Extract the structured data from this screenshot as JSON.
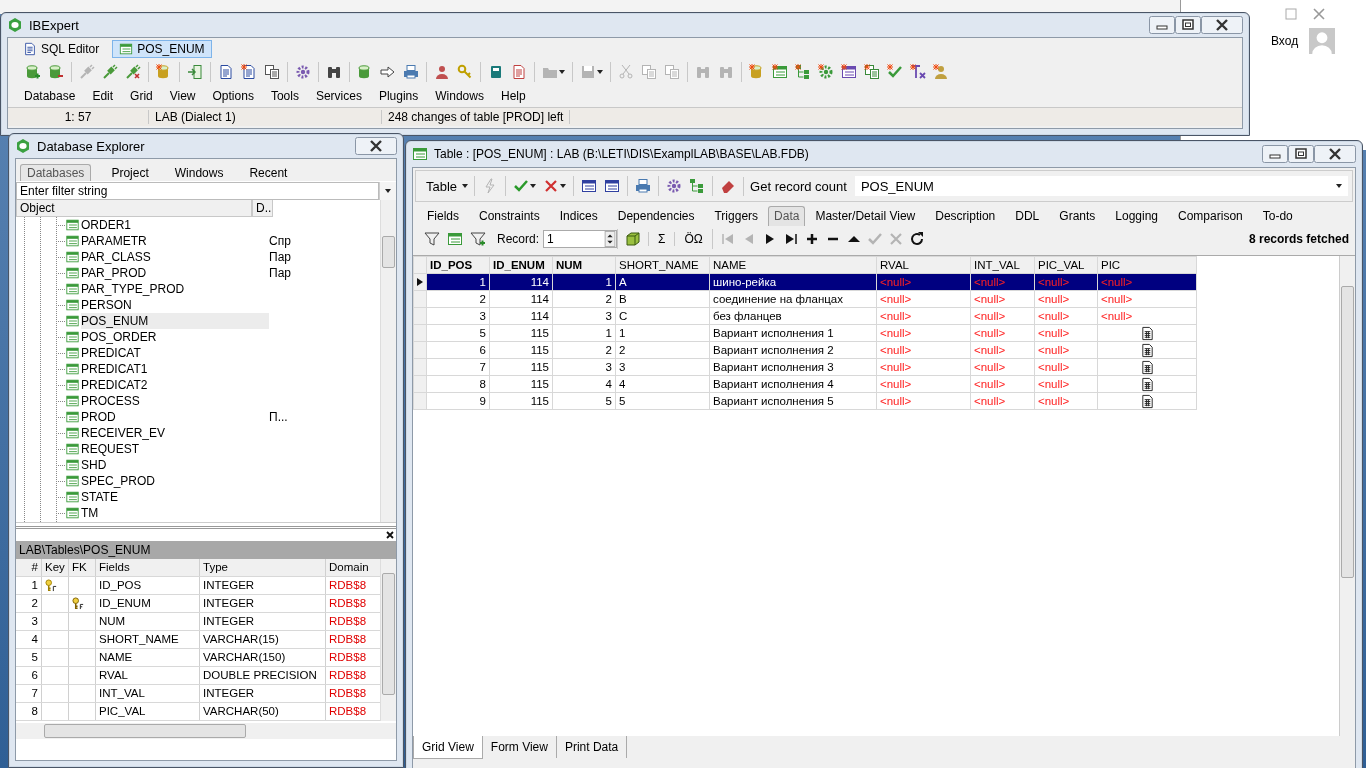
{
  "desktop": {
    "login_text": "Вход"
  },
  "main_window": {
    "title": "IBExpert",
    "doc_tabs": [
      {
        "label": "SQL Editor",
        "kind": "sql",
        "selected": false
      },
      {
        "label": "POS_ENUM",
        "kind": "table",
        "selected": true
      }
    ],
    "toolbar": [
      [
        {
          "kind": "db-add",
          "disabled": false
        },
        {
          "kind": "db-remove",
          "disabled": false
        }
      ],
      [
        {
          "kind": "plug",
          "disabled": true
        },
        {
          "kind": "plug",
          "disabled": false
        },
        {
          "kind": "unplug",
          "disabled": false
        }
      ],
      [
        {
          "kind": "db-new",
          "disabled": false
        }
      ],
      [
        {
          "kind": "door",
          "disabled": false
        }
      ],
      [
        {
          "kind": "doc",
          "disabled": false
        },
        {
          "kind": "doc-new",
          "disabled": false
        },
        {
          "kind": "docs",
          "disabled": false
        }
      ],
      [
        {
          "kind": "gear",
          "disabled": false
        }
      ],
      [
        {
          "kind": "binoc",
          "disabled": false
        }
      ],
      [
        {
          "kind": "db",
          "disabled": false
        },
        {
          "kind": "arrow",
          "disabled": false
        },
        {
          "kind": "printer",
          "disabled": false
        }
      ],
      [
        {
          "kind": "person",
          "disabled": false
        },
        {
          "kind": "key",
          "disabled": false
        }
      ],
      [
        {
          "kind": "book",
          "disabled": false
        },
        {
          "kind": "edit",
          "disabled": false
        }
      ],
      [
        {
          "kind": "folder",
          "disabled": true,
          "dropdown": true
        }
      ],
      [
        {
          "kind": "disk",
          "disabled": true,
          "dropdown": true
        }
      ],
      [
        {
          "kind": "scissors",
          "disabled": true
        },
        {
          "kind": "copy",
          "disabled": true
        },
        {
          "kind": "paste",
          "disabled": true
        }
      ],
      [
        {
          "kind": "binoc",
          "disabled": true
        },
        {
          "kind": "binoc",
          "disabled": true
        }
      ],
      [
        {
          "kind": "db-new",
          "disabled": false
        },
        {
          "kind": "grid-new",
          "disabled": false
        },
        {
          "kind": "tree-new",
          "disabled": false
        },
        {
          "kind": "gear-new",
          "disabled": false
        },
        {
          "kind": "list-new",
          "disabled": false
        },
        {
          "kind": "docs-new",
          "disabled": false
        },
        {
          "kind": "check-new",
          "disabled": false
        },
        {
          "kind": "formula-new",
          "disabled": false
        },
        {
          "kind": "person-new",
          "disabled": false
        }
      ]
    ],
    "menu": [
      "Database",
      "Edit",
      "Grid",
      "View",
      "Options",
      "Tools",
      "Services",
      "Plugins",
      "Windows",
      "Help"
    ],
    "status_bar": [
      "1:  57",
      "LAB (Dialect 1)",
      "248 changes of table [PROD] left"
    ]
  },
  "explorer": {
    "title": "Database Explorer",
    "tabs": [
      {
        "label": "Databases",
        "selected": true
      },
      {
        "label": "Project",
        "selected": false
      },
      {
        "label": "Windows",
        "selected": false
      },
      {
        "label": "Recent",
        "selected": false
      }
    ],
    "filter_placeholder": "Enter filter string",
    "tree_columns": [
      "Object",
      "D.."
    ],
    "objects": [
      {
        "name": "ORDER1",
        "selected": false
      },
      {
        "name": "PARAMETR",
        "description": "Спр",
        "selected": false
      },
      {
        "name": "PAR_CLASS",
        "description": "Пар",
        "selected": false
      },
      {
        "name": "PAR_PROD",
        "description": "Пар",
        "selected": false
      },
      {
        "name": "PAR_TYPE_PROD",
        "selected": false
      },
      {
        "name": "PERSON",
        "selected": false
      },
      {
        "name": "POS_ENUM",
        "selected": true
      },
      {
        "name": "POS_ORDER",
        "selected": false
      },
      {
        "name": "PREDICAT",
        "selected": false
      },
      {
        "name": "PREDICAT1",
        "selected": false
      },
      {
        "name": "PREDICAT2",
        "selected": false
      },
      {
        "name": "PROCESS",
        "selected": false
      },
      {
        "name": "PROD",
        "description": "П...",
        "selected": false
      },
      {
        "name": "RECEIVER_EV",
        "selected": false
      },
      {
        "name": "REQUEST",
        "selected": false
      },
      {
        "name": "SHD",
        "selected": false
      },
      {
        "name": "SPEC_PROD",
        "selected": false
      },
      {
        "name": "STATE",
        "selected": false
      },
      {
        "name": "TM",
        "selected": false
      }
    ],
    "fields_panel": {
      "path": "LAB\\Tables\\POS_ENUM",
      "columns": [
        "#",
        "Key",
        "FK",
        "Fields",
        "Type",
        "Domain"
      ],
      "rows": [
        {
          "number": "1",
          "kind": "primary",
          "field": "ID_POS",
          "type": "INTEGER",
          "domain": "RDB$8"
        },
        {
          "number": "2",
          "kind": "foreign",
          "field": "ID_ENUM",
          "type": "INTEGER",
          "domain": "RDB$8"
        },
        {
          "number": "3",
          "field": "NUM",
          "type": "INTEGER",
          "domain": "RDB$8"
        },
        {
          "number": "4",
          "field": "SHORT_NAME",
          "type": "VARCHAR(15)",
          "domain": "RDB$8"
        },
        {
          "number": "5",
          "field": "NAME",
          "type": "VARCHAR(150)",
          "domain": "RDB$8"
        },
        {
          "number": "6",
          "field": "RVAL",
          "type": "DOUBLE PRECISION",
          "domain": "RDB$8"
        },
        {
          "number": "7",
          "field": "INT_VAL",
          "type": "INTEGER",
          "domain": "RDB$8"
        },
        {
          "number": "8",
          "field": "PIC_VAL",
          "type": "VARCHAR(50)",
          "domain": "RDB$8"
        }
      ]
    }
  },
  "table_window": {
    "title": "Table : [POS_ENUM] : LAB (B:\\LETI\\DIS\\ExamplLAB\\BASE\\LAB.FDB)",
    "table_menu": "Table",
    "toolbar": [
      [
        {
          "kind": "lightning",
          "disabled": true
        }
      ],
      [
        {
          "kind": "check",
          "disabled": false,
          "dropdown": true
        },
        {
          "kind": "cross",
          "disabled": false,
          "dropdown": true
        }
      ],
      [
        {
          "kind": "grid-red",
          "disabled": false
        },
        {
          "kind": "grid-red",
          "disabled": false
        }
      ],
      [
        {
          "kind": "printer",
          "disabled": false
        }
      ],
      [
        {
          "kind": "gear",
          "disabled": false
        },
        {
          "kind": "tree",
          "disabled": false
        }
      ],
      [
        {
          "kind": "eraser",
          "disabled": false
        }
      ]
    ],
    "record_count_button": "Get record count",
    "table_combo": "POS_ENUM",
    "tabs": [
      {
        "label": "Fields",
        "selected": false
      },
      {
        "label": "Constraints",
        "selected": false
      },
      {
        "label": "Indices",
        "selected": false
      },
      {
        "label": "Dependencies",
        "selected": false
      },
      {
        "label": "Triggers",
        "selected": false
      },
      {
        "label": "Data",
        "selected": true
      },
      {
        "label": "Master/Detail View",
        "selected": false
      },
      {
        "label": "Description",
        "selected": false
      },
      {
        "label": "DDL",
        "selected": false
      },
      {
        "label": "Grants",
        "selected": false
      },
      {
        "label": "Logging",
        "selected": false
      },
      {
        "label": "Comparison",
        "selected": false
      },
      {
        "label": "To-do",
        "selected": false
      }
    ],
    "data_tools": [
      {
        "kind": "filter",
        "disabled": false
      },
      {
        "kind": "grid",
        "disabled": false
      },
      {
        "kind": "filter-add",
        "disabled": false
      }
    ],
    "record_label": "Record:",
    "record_value": "1",
    "sum_button": "Σ",
    "case_button": "ÖΩ",
    "nav": [
      {
        "kind": "first",
        "disabled": true
      },
      {
        "kind": "prev",
        "disabled": true
      },
      {
        "kind": "next",
        "disabled": false
      },
      {
        "kind": "last",
        "disabled": false
      },
      {
        "kind": "plus",
        "disabled": false
      },
      {
        "kind": "minus",
        "disabled": false
      },
      {
        "kind": "up",
        "disabled": false
      },
      {
        "kind": "check",
        "disabled": true
      },
      {
        "kind": "cross",
        "disabled": true
      },
      {
        "kind": "refresh",
        "disabled": false
      }
    ],
    "fetched": "8 records fetched",
    "grid": {
      "columns": [
        {
          "label": "ID_POS",
          "key": true,
          "kind": "numeric"
        },
        {
          "label": "ID_ENUM",
          "key": true,
          "kind": "numeric"
        },
        {
          "label": "NUM",
          "key": true,
          "kind": "numeric"
        },
        {
          "label": "SHORT_NAME",
          "key": false,
          "kind": "text"
        },
        {
          "label": "NAME",
          "key": false,
          "kind": "text"
        },
        {
          "label": "RVAL",
          "key": false,
          "kind": "text"
        },
        {
          "label": "INT_VAL",
          "key": false,
          "kind": "text"
        },
        {
          "label": "PIC_VAL",
          "key": false,
          "kind": "text"
        },
        {
          "label": "PIC",
          "key": false,
          "kind": "text"
        }
      ],
      "rows": [
        {
          "selected": true,
          "cells": [
            {
              "text": "1"
            },
            {
              "text": "114"
            },
            {
              "text": "1"
            },
            {
              "text": "A"
            },
            {
              "text": "шино-рейка"
            },
            {
              "kind": "null",
              "text": "<null>"
            },
            {
              "kind": "null",
              "text": "<null>"
            },
            {
              "kind": "null",
              "text": "<null>"
            },
            {
              "kind": "null",
              "text": "<null>"
            }
          ]
        },
        {
          "selected": false,
          "cells": [
            {
              "text": "2"
            },
            {
              "text": "114"
            },
            {
              "text": "2"
            },
            {
              "text": "B"
            },
            {
              "text": "соединение на фланцах"
            },
            {
              "kind": "null",
              "text": "<null>"
            },
            {
              "kind": "null",
              "text": "<null>"
            },
            {
              "kind": "null",
              "text": "<null>"
            },
            {
              "kind": "null",
              "text": "<null>"
            }
          ]
        },
        {
          "selected": false,
          "cells": [
            {
              "text": "3"
            },
            {
              "text": "114"
            },
            {
              "text": "3"
            },
            {
              "text": "C"
            },
            {
              "text": "без фланцев"
            },
            {
              "kind": "null",
              "text": "<null>"
            },
            {
              "kind": "null",
              "text": "<null>"
            },
            {
              "kind": "null",
              "text": "<null>"
            },
            {
              "kind": "null",
              "text": "<null>"
            }
          ]
        },
        {
          "selected": false,
          "cells": [
            {
              "text": "5"
            },
            {
              "text": "115"
            },
            {
              "text": "1"
            },
            {
              "text": "1"
            },
            {
              "text": "Вариант исполнения 1"
            },
            {
              "kind": "null",
              "text": "<null>"
            },
            {
              "kind": "null",
              "text": "<null>"
            },
            {
              "kind": "null",
              "text": "<null>"
            },
            {
              "kind": "blob"
            }
          ]
        },
        {
          "selected": false,
          "cells": [
            {
              "text": "6"
            },
            {
              "text": "115"
            },
            {
              "text": "2"
            },
            {
              "text": "2"
            },
            {
              "text": "Вариант исполнения 2"
            },
            {
              "kind": "null",
              "text": "<null>"
            },
            {
              "kind": "null",
              "text": "<null>"
            },
            {
              "kind": "null",
              "text": "<null>"
            },
            {
              "kind": "blob"
            }
          ]
        },
        {
          "selected": false,
          "cells": [
            {
              "text": "7"
            },
            {
              "text": "115"
            },
            {
              "text": "3"
            },
            {
              "text": "3"
            },
            {
              "text": "Вариант исполнения 3"
            },
            {
              "kind": "null",
              "text": "<null>"
            },
            {
              "kind": "null",
              "text": "<null>"
            },
            {
              "kind": "null",
              "text": "<null>"
            },
            {
              "kind": "blob"
            }
          ]
        },
        {
          "selected": false,
          "cells": [
            {
              "text": "8"
            },
            {
              "text": "115"
            },
            {
              "text": "4"
            },
            {
              "text": "4"
            },
            {
              "text": "Вариант исполнения 4"
            },
            {
              "kind": "null",
              "text": "<null>"
            },
            {
              "kind": "null",
              "text": "<null>"
            },
            {
              "kind": "null",
              "text": "<null>"
            },
            {
              "kind": "blob"
            }
          ]
        },
        {
          "selected": false,
          "cells": [
            {
              "text": "9"
            },
            {
              "text": "115"
            },
            {
              "text": "5"
            },
            {
              "text": "5"
            },
            {
              "text": "Вариант исполнения 5"
            },
            {
              "kind": "null",
              "text": "<null>"
            },
            {
              "kind": "null",
              "text": "<null>"
            },
            {
              "kind": "null",
              "text": "<null>"
            },
            {
              "kind": "blob"
            }
          ]
        }
      ]
    },
    "view_tabs": [
      {
        "label": "Grid View",
        "selected": true
      },
      {
        "label": "Form View",
        "selected": false
      },
      {
        "label": "Print Data",
        "selected": false
      }
    ]
  }
}
